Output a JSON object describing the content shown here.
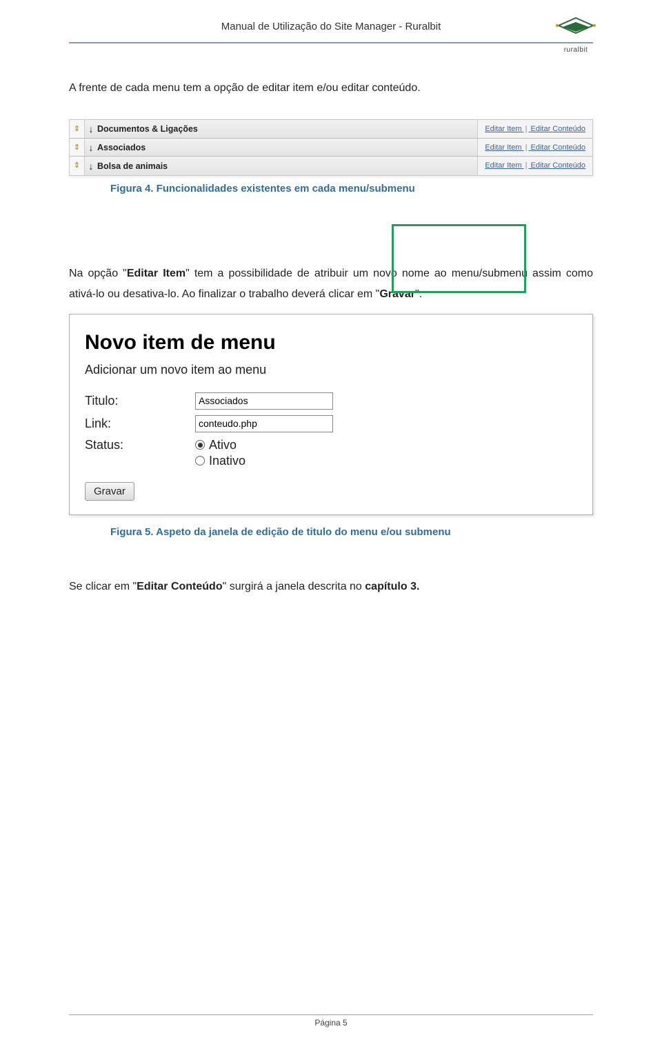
{
  "header": {
    "title": "Manual de Utilização do Site Manager - Ruralbit",
    "logo_text": "ruralbit"
  },
  "intro_paragraph": "A frente de cada menu tem a opção de editar item e/ou editar conteúdo.",
  "figure4": {
    "menu_rows": [
      {
        "label": "Documentos & Ligações",
        "edit_item": "Editar Item",
        "edit_content": "Editar Conteúdo"
      },
      {
        "label": "Associados",
        "edit_item": "Editar Item",
        "edit_content": "Editar Conteúdo"
      },
      {
        "label": "Bolsa de animais",
        "edit_item": "Editar Item",
        "edit_content": "Editar Conteúdo"
      }
    ],
    "separator": "|",
    "caption": "Figura 4. Funcionalidades existentes em cada menu/submenu"
  },
  "paragraph2": {
    "pre": "Na opção \"",
    "bold1": "Editar Item",
    "mid": "\" tem a possibilidade de atribuir um novo nome ao menu/submenu assim como ativá-lo ou desativa-lo. Ao finalizar o trabalho deverá clicar em \"",
    "bold2": "Gravar",
    "post": "\"."
  },
  "figure5": {
    "form_title": "Novo item de menu",
    "form_subtitle": "Adicionar um novo item ao menu",
    "label_titulo": "Titulo:",
    "value_titulo": "Associados",
    "label_link": "Link:",
    "value_link": "conteudo.php",
    "label_status": "Status:",
    "radio_ativo": "Ativo",
    "radio_inativo": "Inativo",
    "save_button": "Gravar",
    "caption": "Figura 5. Aspeto da janela de edição de titulo do menu e/ou submenu"
  },
  "paragraph3": {
    "pre": "Se clicar em \"",
    "bold1": "Editar Conteúdo",
    "mid": "\" surgirá a janela descrita no ",
    "bold2": "capítulo 3.",
    "post": ""
  },
  "footer": "Página 5"
}
